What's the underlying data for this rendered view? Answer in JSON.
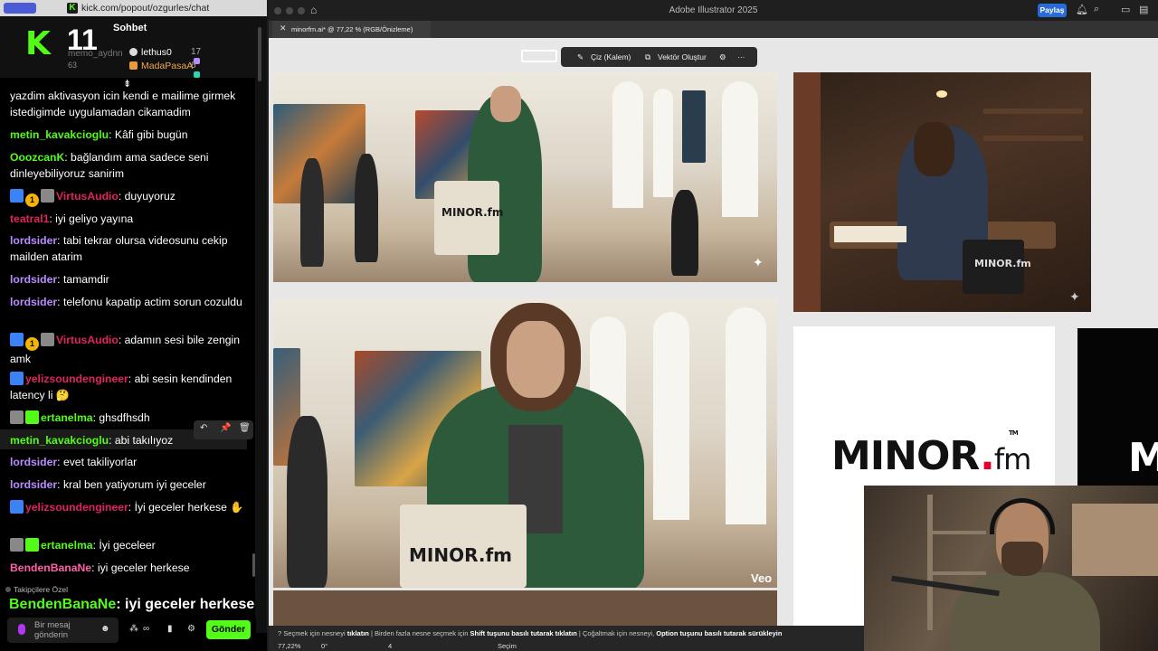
{
  "chat": {
    "url": "kick.com/popout/ozgurles/chat",
    "title": "Sohbet",
    "header_number": "11",
    "ghost_user": "memo_aydnn",
    "ghost_count": "63",
    "top_users": [
      {
        "name": "lethus0",
        "count": "17"
      },
      {
        "name": "MadaPasaA",
        "count": "6"
      }
    ],
    "messages": [
      {
        "user": "",
        "text": "yazdim aktivasyon icin kendi e mailime girmek istedigimde uygulamadan cikamadim"
      },
      {
        "user": "metin_kavakcioglu",
        "text": "Kâfi gibi bugün"
      },
      {
        "user": "OoozcanK",
        "text": "bağlandım ama sadece seni dinleyebiliyoruz sanirim"
      },
      {
        "user": "VirtusAudio",
        "text": "duyuyoruz"
      },
      {
        "user": "teatral1",
        "text": "iyi geliyo yayına"
      },
      {
        "user": "lordsider",
        "text": "tabi tekrar olursa videosunu cekip mailden atarim"
      },
      {
        "user": "lordsider",
        "text": "tamamdir"
      },
      {
        "user": "lordsider",
        "text": "telefonu kapatip actim sorun cozuldu"
      },
      {
        "user": "VirtusAudio",
        "text": "adamın sesi bile zengin amk"
      },
      {
        "user": "yelizsoundengineer",
        "text": "abi sesin kendinden latency li 🤔"
      },
      {
        "user": "ertanelma",
        "text": "ghsdfhsdh"
      },
      {
        "user": "metin_kavakcioglu",
        "text": "abi takılıyoz"
      },
      {
        "user": "lordsider",
        "text": "evet takiliyorlar"
      },
      {
        "user": "lordsider",
        "text": "kral ben yatiyorum iyi geceler"
      },
      {
        "user": "yelizsoundengineer",
        "text": "İyi geceler herkese ✋"
      },
      {
        "user": "ertanelma",
        "text": "İyi geceleer"
      },
      {
        "user": "BendenBanaNe",
        "text": "iyi geceler herkese"
      }
    ],
    "coin_badge": "1",
    "followers_label": "Takipçilere Özel",
    "overlay": {
      "user": "BendenBanaNe",
      "text": "iyi geceler herkese"
    },
    "input_placeholder": "Bir mesaj gönderin",
    "send_label": "Gönder",
    "colors": {
      "metin_kavakcioglu": "#53fc18",
      "OoozcanK": "#53fc18",
      "VirtusAudio": "#e0245e",
      "teatral1": "#e0245e",
      "lordsider": "#b98cff",
      "yelizsoundengineer": "#e0245e",
      "ertanelma": "#53fc18",
      "BendenBanaNe": "#ff5fa8"
    }
  },
  "illustrator": {
    "app_title": "Adobe Illustrator 2025",
    "share_label": "Paylaş",
    "doc_tab": "minorfm.ai* @ 77,22 % (RGB/Önizleme)",
    "ctx": {
      "draw": "Çiz (Kalem)",
      "vector": "Vektör Oluştur",
      "more": "···"
    },
    "bag_text": "MINOR.fm",
    "veo_label": "Veo",
    "logo": {
      "main": "MINOR",
      "dot": ".",
      "fm": "fm",
      "tm": "TM",
      "dark_letter": "M"
    },
    "status_hint": {
      "a1": "Seçmek için nesneyi ",
      "b1": "tıklatın",
      "a2": " | Birden fazla nesne seçmek için ",
      "b2": "Shift tuşunu basılı tutarak tıklatın",
      "a3": " | Çoğaltmak için nesneyi, ",
      "b3": "Option tuşunu basılı tutarak sürükleyin"
    },
    "zoom": "77,22%",
    "rotation": "0°",
    "artboard": "4",
    "mode": "Seçim"
  }
}
